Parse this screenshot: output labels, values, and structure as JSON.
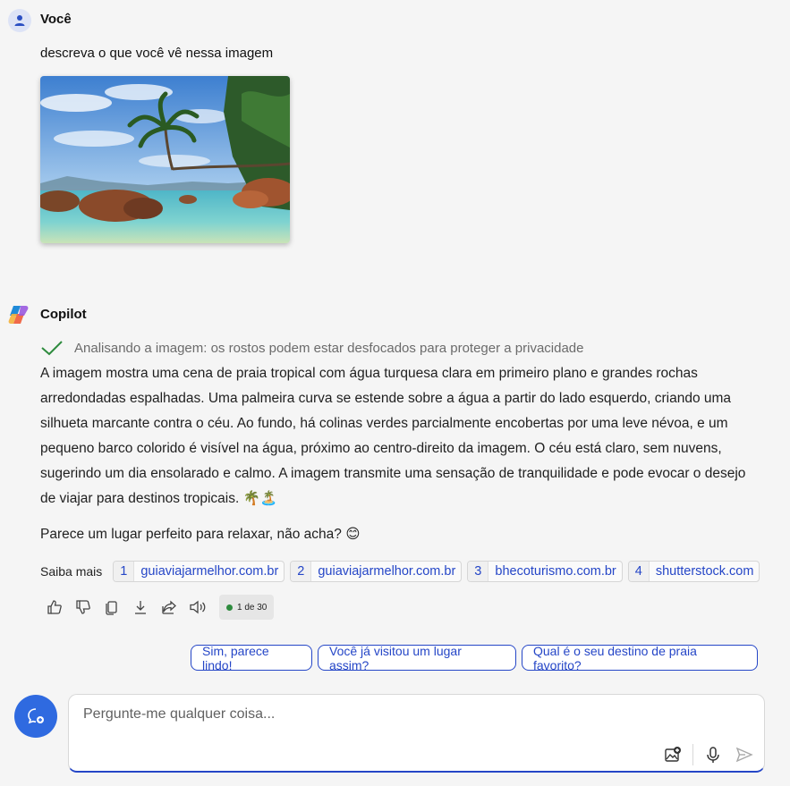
{
  "user": {
    "name": "Você",
    "message": "descreva o que você vê nessa imagem"
  },
  "assistant": {
    "name": "Copilot",
    "status": "Analisando a imagem: os rostos podem estar desfocados para proteger a privacidade",
    "paragraph1": "A imagem mostra uma cena de praia tropical com água turquesa clara em primeiro plano e grandes rochas arredondadas espalhadas. Uma palmeira curva se estende sobre a água a partir do lado esquerdo, criando uma silhueta marcante contra o céu. Ao fundo, há colinas verdes parcialmente encobertas por uma leve névoa, e um pequeno barco colorido é visível na água, próximo ao centro-direito da imagem. O céu está claro, sem nuvens, sugerindo um dia ensolarado e calmo. A imagem transmite uma sensação de tranquilidade e pode evocar o desejo de viajar para destinos tropicais. 🌴🏝️",
    "paragraph2": "Parece um lugar perfeito para relaxar, não acha? 😊"
  },
  "sources": {
    "label": "Saiba mais",
    "items": [
      {
        "num": "1",
        "site": "guiaviajarmelhor.com.br"
      },
      {
        "num": "2",
        "site": "guiaviajarmelhor.com.br"
      },
      {
        "num": "3",
        "site": "bhecoturismo.com.br"
      },
      {
        "num": "4",
        "site": "shutterstock.com"
      }
    ]
  },
  "response_counter": "1 de 30",
  "suggestions": [
    "Sim, parece lindo!",
    "Você já visitou um lugar assim?",
    "Qual é o seu destino de praia favorito?"
  ],
  "composer": {
    "placeholder": "Pergunte-me qualquer coisa..."
  },
  "colors": {
    "accent": "#2546c7",
    "new_chat": "#2f6ae0",
    "background": "#f5f5f5"
  },
  "icons": [
    "user-icon",
    "copilot-logo",
    "check-icon",
    "thumbs-up-icon",
    "thumbs-down-icon",
    "copy-icon",
    "download-icon",
    "share-icon",
    "speaker-icon",
    "new-chat-icon",
    "image-add-icon",
    "microphone-icon",
    "send-icon"
  ]
}
